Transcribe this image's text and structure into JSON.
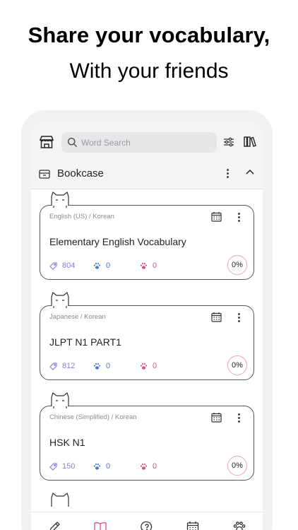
{
  "headline": {
    "line1": "Share your vocabulary,",
    "line2": "With your friends"
  },
  "search": {
    "placeholder": "Word Search"
  },
  "bookcase": {
    "title": "Bookcase"
  },
  "cards": [
    {
      "lang": "English (US) / Korean",
      "title": "Elementary English Vocabulary",
      "words": "804",
      "blue": "0",
      "pink": "0",
      "progress": "0%"
    },
    {
      "lang": "Japanese / Korean",
      "title": "JLPT N1 PART1",
      "words": "812",
      "blue": "0",
      "pink": "0",
      "progress": "0%"
    },
    {
      "lang": "Chinese (Simplified) / Korean",
      "title": "HSK N1",
      "words": "150",
      "blue": "0",
      "pink": "0",
      "progress": "0%"
    }
  ],
  "colors": {
    "word_count": "#8a7ee0",
    "blue_paw": "#4a78d4",
    "pink_paw": "#e2507a",
    "active_nav": "#e2507a"
  },
  "icons": [
    "store-icon",
    "search-icon",
    "filter-icon",
    "library-icon",
    "box-icon",
    "chevron-up-icon",
    "calendar-icon",
    "tag-icon",
    "paw-icon",
    "pencil-icon",
    "book-icon",
    "question-icon"
  ],
  "bottom_nav": {
    "active": "book"
  }
}
